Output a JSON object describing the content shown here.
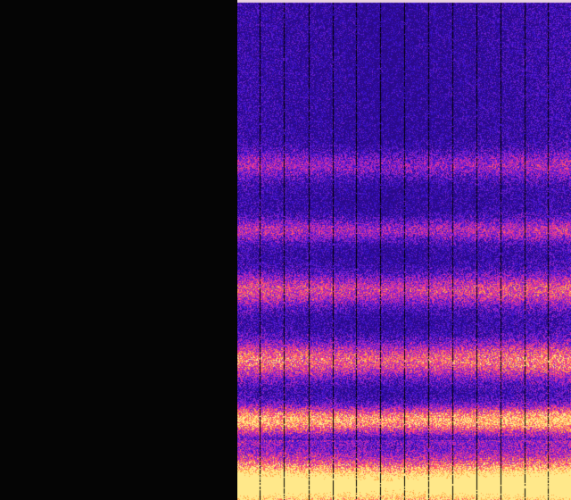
{
  "image": {
    "kind": "heatmap-texture",
    "palette": [
      "#000000",
      "#2a0a8a",
      "#3a12c8",
      "#6a1fd0",
      "#a426c8",
      "#e0309a",
      "#ff5a6a",
      "#ffa84a",
      "#ffe88a",
      "#fffbb0"
    ],
    "background": "#050505",
    "left_region": "blank",
    "stripe_color": "#000000",
    "top_edge_color": "#e8d0e0"
  }
}
